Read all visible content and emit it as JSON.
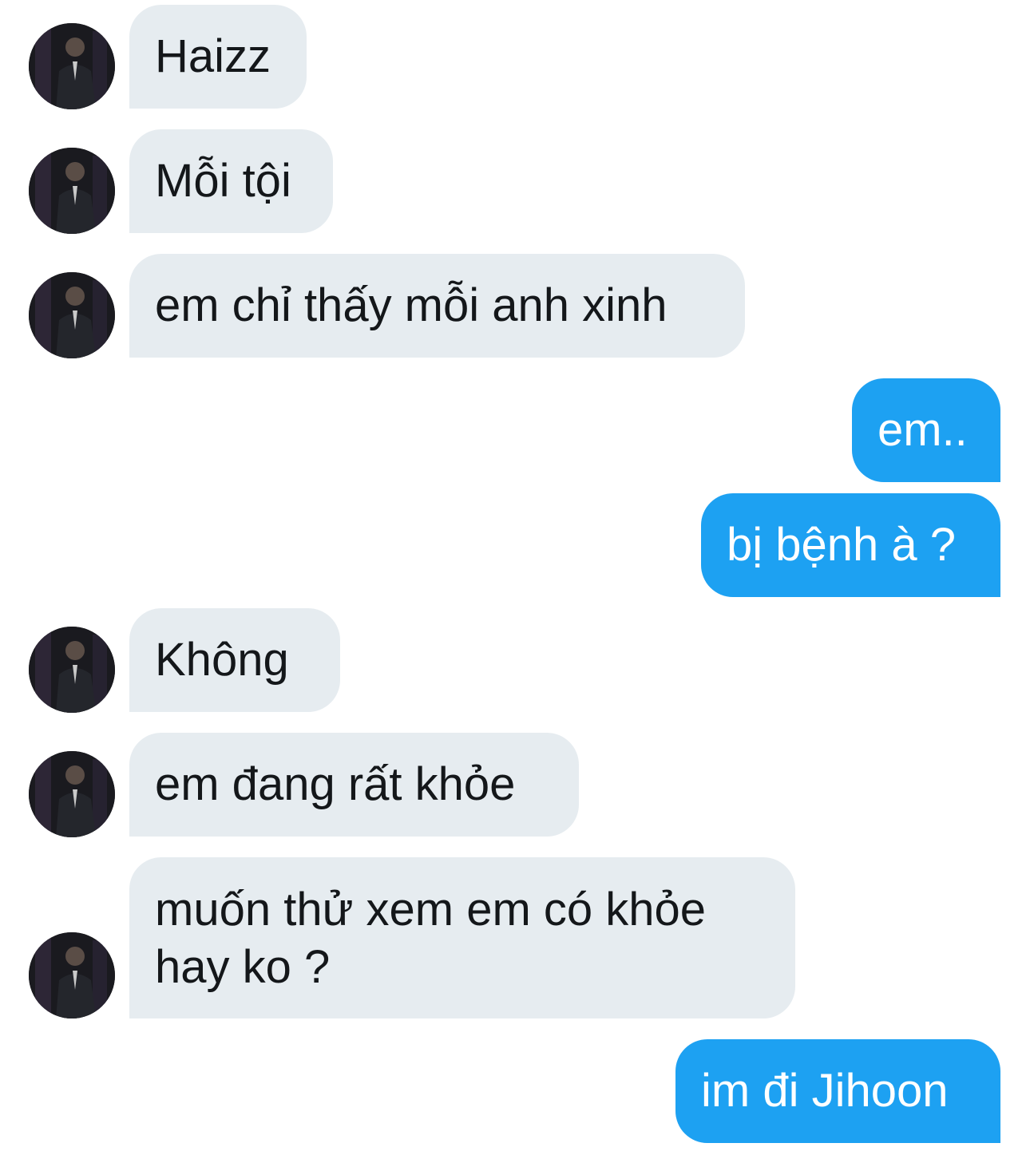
{
  "conversation": {
    "messages": [
      {
        "direction": "incoming",
        "text": "Haizz",
        "avatar_icon": "contact-avatar-icon"
      },
      {
        "direction": "incoming",
        "text": "Mỗi tội",
        "avatar_icon": "contact-avatar-icon"
      },
      {
        "direction": "incoming",
        "text": "em chỉ thấy mỗi anh xinh",
        "avatar_icon": "contact-avatar-icon"
      },
      {
        "direction": "outgoing",
        "text": "em.."
      },
      {
        "direction": "outgoing",
        "text": "bị bệnh à ?"
      },
      {
        "direction": "incoming",
        "text": "Không",
        "avatar_icon": "contact-avatar-icon"
      },
      {
        "direction": "incoming",
        "text": "em đang rất khỏe",
        "avatar_icon": "contact-avatar-icon"
      },
      {
        "direction": "incoming",
        "text": "muốn thử xem em có khỏe hay ko ?",
        "avatar_icon": "contact-avatar-icon"
      },
      {
        "direction": "outgoing",
        "text": "im đi Jihoon"
      }
    ]
  },
  "colors": {
    "background": "#ffffff",
    "incoming_bubble": "#e6ecf0",
    "incoming_text": "#14171a",
    "outgoing_bubble": "#1da1f2",
    "outgoing_text": "#ffffff"
  }
}
